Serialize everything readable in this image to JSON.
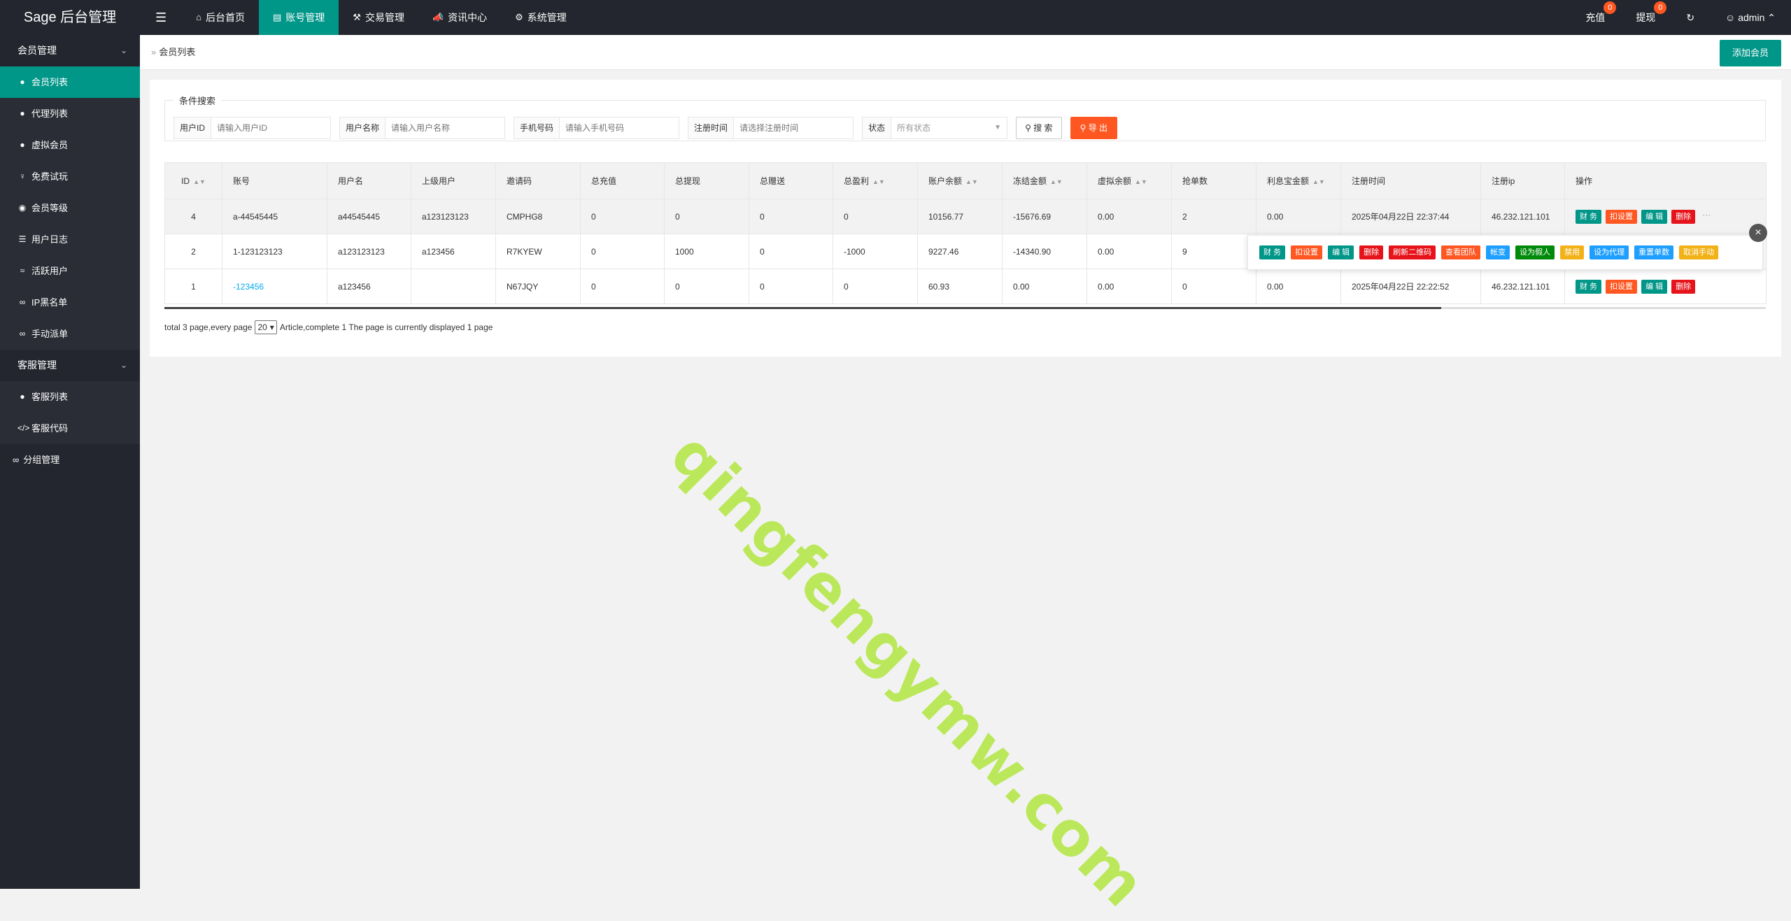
{
  "app": {
    "title": "Sage 后台管理"
  },
  "topnav": [
    {
      "icon": "home-icon",
      "label": "后台首页"
    },
    {
      "icon": "id-card-icon",
      "label": "账号管理",
      "active": true
    },
    {
      "icon": "gavel-icon",
      "label": "交易管理"
    },
    {
      "icon": "bullhorn-icon",
      "label": "资讯中心"
    },
    {
      "icon": "cogs-icon",
      "label": "系统管理"
    }
  ],
  "topright": {
    "recharge": {
      "label": "充值",
      "badge": "0"
    },
    "withdraw": {
      "label": "提现",
      "badge": "0"
    },
    "refresh_icon": "refresh-icon",
    "user": "admin"
  },
  "sidebar": {
    "group1": "会员管理",
    "items1": [
      {
        "icon": "user-icon",
        "label": "会员列表",
        "active": true
      },
      {
        "icon": "users-icon",
        "label": "代理列表"
      },
      {
        "icon": "user-secret-icon",
        "label": "虚拟会员"
      },
      {
        "icon": "female-icon",
        "label": "免费试玩"
      },
      {
        "icon": "car-icon",
        "label": "会员等级"
      },
      {
        "icon": "list-icon",
        "label": "用户日志"
      },
      {
        "icon": "wifi-icon",
        "label": "活跃用户"
      },
      {
        "icon": "link-icon",
        "label": "IP黑名单"
      },
      {
        "icon": "link-icon",
        "label": "手动派单"
      }
    ],
    "group2": "客服管理",
    "items2": [
      {
        "icon": "user-icon",
        "label": "客服列表"
      },
      {
        "icon": "code-icon",
        "label": "客服代码"
      }
    ],
    "single": {
      "icon": "link-icon",
      "label": "分组管理"
    }
  },
  "breadcrumb": "会员列表",
  "add_button": "添加会员",
  "search": {
    "legend": "条件搜索",
    "user_id": {
      "label": "用户ID",
      "placeholder": "请输入用户ID"
    },
    "username": {
      "label": "用户名称",
      "placeholder": "请输入用户名称"
    },
    "phone": {
      "label": "手机号码",
      "placeholder": "请输入手机号码"
    },
    "reg_time": {
      "label": "注册时间",
      "placeholder": "请选择注册时间"
    },
    "status": {
      "label": "状态",
      "value": "所有状态"
    },
    "search_button": "搜 索",
    "export_button": "导 出"
  },
  "table": {
    "headers": [
      "ID",
      "账号",
      "用户名",
      "上级用户",
      "邀请码",
      "总充值",
      "总提现",
      "总赠送",
      "总盈利",
      "账户余额",
      "冻结金额",
      "虚拟余额",
      "抢单数",
      "利息宝金额",
      "注册时间",
      "注册ip",
      "操作"
    ],
    "rows": [
      {
        "id": "4",
        "account": "a-44545445",
        "username": "a44545445",
        "parent": "a123123123",
        "invite": "CMPHG8",
        "recharge": "0",
        "withdraw": "0",
        "gift": "0",
        "profit": "0",
        "balance": "10156.77",
        "frozen": "-15676.69",
        "virtual": "0.00",
        "orders": "2",
        "interest": "0.00",
        "reg_time": "2025年04月22日 22:37:44",
        "reg_ip": "46.232.121.101"
      },
      {
        "id": "2",
        "account": "1-123123123",
        "username": "a123123123",
        "parent": "a123456",
        "invite": "R7KYEW",
        "recharge": "0",
        "withdraw": "1000",
        "gift": "0",
        "profit": "-1000",
        "balance": "9227.46",
        "frozen": "-14340.90",
        "virtual": "0.00",
        "orders": "9",
        "interest": "",
        "reg_time": "",
        "reg_ip": ""
      },
      {
        "id": "1",
        "account": "-123456",
        "username": "a123456",
        "parent": "",
        "invite": "N67JQY",
        "recharge": "0",
        "withdraw": "0",
        "gift": "0",
        "profit": "0",
        "balance": "60.93",
        "frozen": "0.00",
        "virtual": "0.00",
        "orders": "0",
        "interest": "0.00",
        "reg_time": "2025年04月22日 22:22:52",
        "reg_ip": "46.232.121.101"
      }
    ],
    "row_actions": [
      "财 务",
      "扣设置",
      "编 辑",
      "删除"
    ],
    "popup_actions": [
      "财 务",
      "扣设置",
      "编 辑",
      "删除",
      "刷新二维码",
      "查看团队",
      "帐变",
      "设为假人",
      "禁用",
      "设为代理",
      "重置单数",
      "取消手动"
    ],
    "more": "···"
  },
  "pager": {
    "prefix": "total 3 page,every page",
    "per_page": "20",
    "suffix": "Article,complete 1 The page is currently displayed 1 page"
  },
  "watermark": "qingfengymw.com",
  "colors": {
    "accent": "#009688",
    "dark": "#23262e",
    "orange": "#ff5722",
    "red": "#e6141a",
    "blue": "#1e9fff"
  }
}
